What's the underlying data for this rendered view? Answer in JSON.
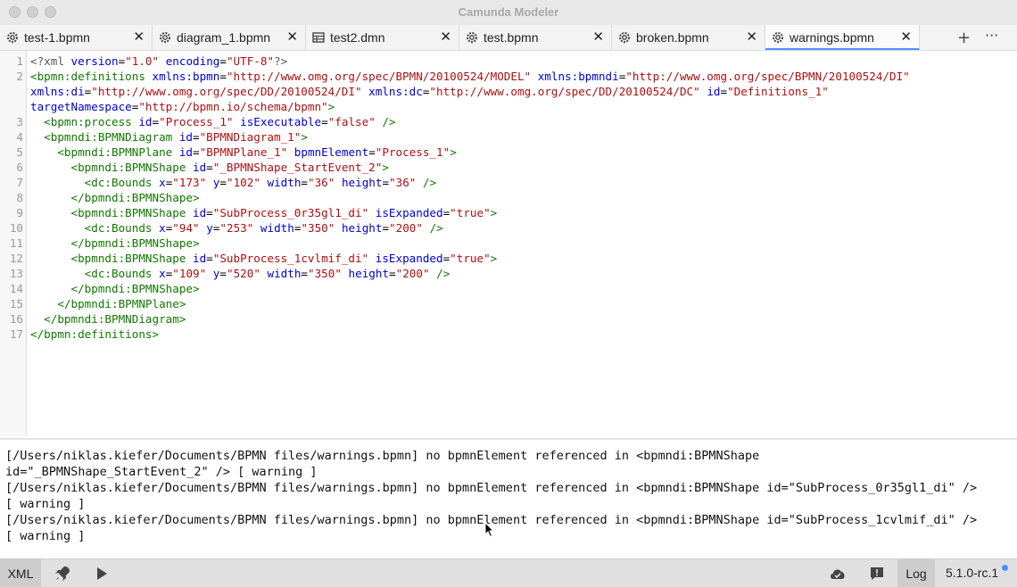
{
  "window": {
    "title": "Camunda Modeler"
  },
  "tabs": [
    {
      "label": "test-1.bpmn",
      "icon": "gear-icon",
      "active": false
    },
    {
      "label": "diagram_1.bpmn",
      "icon": "gear-icon",
      "active": false
    },
    {
      "label": "test2.dmn",
      "icon": "table-icon",
      "active": false
    },
    {
      "label": "test.bpmn",
      "icon": "gear-icon",
      "active": false
    },
    {
      "label": "broken.bpmn",
      "icon": "gear-icon",
      "active": false
    },
    {
      "label": "warnings.bpmn",
      "icon": "gear-icon",
      "active": true
    }
  ],
  "tab_actions": {
    "close_glyph": "✕",
    "add_glyph": "+",
    "more_glyph": "···"
  },
  "editor": {
    "line_numbers": [
      "1",
      "2",
      "3",
      "4",
      "5",
      "6",
      "7",
      "8",
      "9",
      "10",
      "11",
      "12",
      "13",
      "14",
      "15",
      "16",
      "17"
    ],
    "lines": [
      "<?xml version=\"1.0\" encoding=\"UTF-8\"?>",
      "<bpmn:definitions xmlns:bpmn=\"http://www.omg.org/spec/BPMN/20100524/MODEL\" xmlns:bpmndi=\"http://www.omg.org/spec/BPMN/20100524/DI\"",
      "xmlns:di=\"http://www.omg.org/spec/DD/20100524/DI\" xmlns:dc=\"http://www.omg.org/spec/DD/20100524/DC\" id=\"Definitions_1\"",
      "targetNamespace=\"http://bpmn.io/schema/bpmn\">",
      "  <bpmn:process id=\"Process_1\" isExecutable=\"false\" />",
      "  <bpmndi:BPMNDiagram id=\"BPMNDiagram_1\">",
      "    <bpmndi:BPMNPlane id=\"BPMNPlane_1\" bpmnElement=\"Process_1\">",
      "      <bpmndi:BPMNShape id=\"_BPMNShape_StartEvent_2\">",
      "        <dc:Bounds x=\"173\" y=\"102\" width=\"36\" height=\"36\" />",
      "      </bpmndi:BPMNShape>",
      "      <bpmndi:BPMNShape id=\"SubProcess_0r35gl1_di\" isExpanded=\"true\">",
      "        <dc:Bounds x=\"94\" y=\"253\" width=\"350\" height=\"200\" />",
      "      </bpmndi:BPMNShape>",
      "      <bpmndi:BPMNShape id=\"SubProcess_1cvlmif_di\" isExpanded=\"true\">",
      "        <dc:Bounds x=\"109\" y=\"520\" width=\"350\" height=\"200\" />",
      "      </bpmndi:BPMNShape>",
      "    </bpmndi:BPMNPlane>",
      "  </bpmndi:BPMNDiagram>",
      "</bpmn:definitions>"
    ]
  },
  "console": {
    "lines": [
      "[/Users/niklas.kiefer/Documents/BPMN files/warnings.bpmn] no bpmnElement referenced in <bpmndi:BPMNShape",
      "id=\"_BPMNShape_StartEvent_2\" /> [ warning ]",
      "[/Users/niklas.kiefer/Documents/BPMN files/warnings.bpmn] no bpmnElement referenced in <bpmndi:BPMNShape id=\"SubProcess_0r35gl1_di\" />",
      "[ warning ]",
      "[/Users/niklas.kiefer/Documents/BPMN files/warnings.bpmn] no bpmnElement referenced in <bpmndi:BPMNShape id=\"SubProcess_1cvlmif_di\" />",
      "[ warning ]"
    ]
  },
  "statusbar": {
    "xml_label": "XML",
    "log_label": "Log",
    "version": "5.1.0-rc.1",
    "icons": [
      "rocket-icon",
      "play-icon",
      "cloud-check-icon",
      "feedback-icon"
    ],
    "colors": {
      "accent": "#4d90ff"
    }
  }
}
